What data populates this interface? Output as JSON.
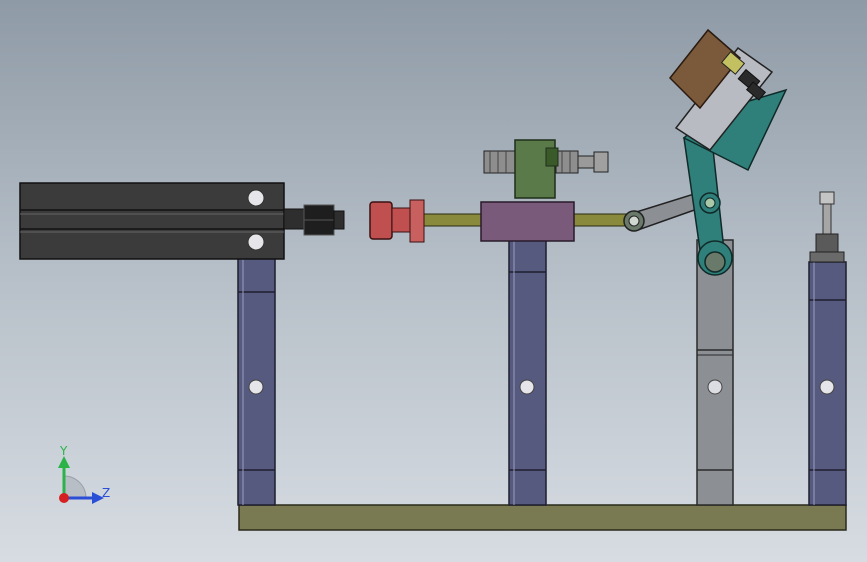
{
  "triad": {
    "y_label": "Y",
    "z_label": "Z"
  },
  "colors": {
    "viewport_top": "#8e9aa6",
    "viewport_bottom": "#d7dce2",
    "support_post": "#555a7e",
    "base_plate": "#7a7a52",
    "cylinder_body": "#3b3b3b",
    "rod": "#8a8a3c",
    "rod_head": "#c05050",
    "slider_block": "#7a5a7a",
    "clamp_block": "#5a7a4a",
    "arm_teal": "#2f7f7a",
    "arm_gray": "#8c8f94",
    "block_brown": "#7a5a3a",
    "axis_y": "#2bb34a",
    "axis_z": "#2a4fd6",
    "axis_origin": "#d42020"
  },
  "icons": {
    "view_triad": "xyz-triad-icon"
  }
}
